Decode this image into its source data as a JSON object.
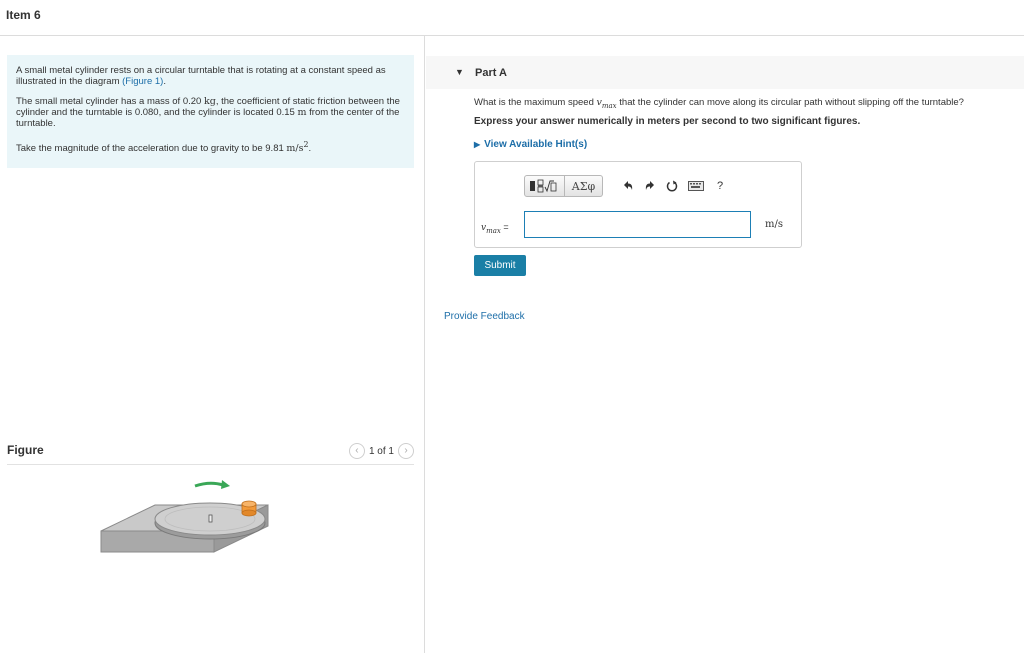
{
  "header": {
    "title": "Item 6"
  },
  "problem": {
    "p1_text": "A small metal cylinder rests on a circular turntable that is rotating at a constant speed as illustrated in the diagram ",
    "p1_link": "(Figure 1)",
    "p1_end": ".",
    "p2_a": "The small metal cylinder has a mass of 0.20 ",
    "p2_kg": "kg",
    "p2_b": ", the coefficient of static friction between the cylinder and the turntable is 0.080, and the cylinder is located 0.15 ",
    "p2_m": "m",
    "p2_c": " from the center of the turntable.",
    "p3_a": "Take the magnitude of the acceleration due to gravity to be 9.81 ",
    "p3_unit": "m/s",
    "p3_sup": "2",
    "p3_end": "."
  },
  "figure": {
    "label": "Figure",
    "pager_text": "1 of 1",
    "prev_icon": "chevron-left-icon",
    "next_icon": "chevron-right-icon"
  },
  "part": {
    "label": "Part A",
    "question_a": "What is the maximum speed ",
    "var": "v",
    "var_sub": "max",
    "question_b": " that the cylinder can move along its circular path without slipping off the turntable?",
    "instruction": "Express your answer numerically in meters per second to two significant figures.",
    "hints_label": "View Available Hint(s)",
    "answer": {
      "label_var": "v",
      "label_sub": "max",
      "label_eq": " =",
      "value": "",
      "unit": "m/s"
    },
    "toolbar": {
      "greek_label": "ΑΣφ",
      "icons": [
        "templates-icon",
        "greek-symbols-icon",
        "undo-icon",
        "redo-icon",
        "reset-icon",
        "keyboard-icon",
        "help-icon"
      ],
      "help_label": "?"
    },
    "submit_label": "Submit",
    "feedback_label": "Provide Feedback"
  },
  "colors": {
    "link": "#1d6ea8",
    "problem_bg": "#eaf6f9",
    "submit_bg": "#1a7fa6",
    "arrow_green": "#3aa757",
    "cylinder_orange": "#f29a3a"
  }
}
